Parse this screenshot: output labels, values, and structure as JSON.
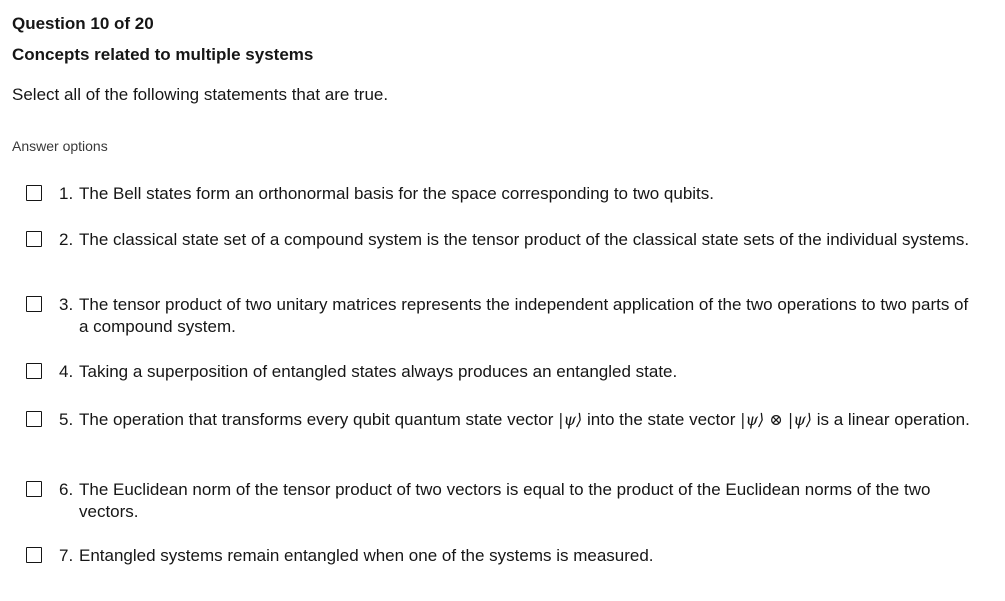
{
  "question": {
    "number_label": "Question 10 of 20",
    "topic": "Concepts related to multiple systems",
    "prompt": "Select all of the following statements that are true."
  },
  "answer_options": {
    "label": "Answer options",
    "items": [
      {
        "num": "1.",
        "text": "The Bell states form an orthonormal basis for the space corresponding to two qubits.",
        "checked": false
      },
      {
        "num": "2.",
        "text": "The classical state set of a compound system is the tensor product of the classical state sets of the individual systems.",
        "checked": false
      },
      {
        "num": "3.",
        "text": "The tensor product of two unitary matrices represents the independent application of the two operations to two parts of a compound system.",
        "checked": false
      },
      {
        "num": "4.",
        "text": "Taking a superposition of entangled states always produces an entangled state.",
        "checked": false
      },
      {
        "num": "5.",
        "text_a": "The operation that transforms every qubit quantum state vector ",
        "ket1": "|ψ⟩",
        "text_b": " into the state vector ",
        "ket2": "|ψ⟩ ⊗ |ψ⟩",
        "text_c": " is a linear operation.",
        "checked": false
      },
      {
        "num": "6.",
        "text": "The Euclidean norm of the tensor product of two vectors is equal to the product of the Euclidean norms of the two vectors.",
        "checked": false
      },
      {
        "num": "7.",
        "text": "Entangled systems remain entangled when one of the systems is measured.",
        "checked": false
      }
    ]
  }
}
